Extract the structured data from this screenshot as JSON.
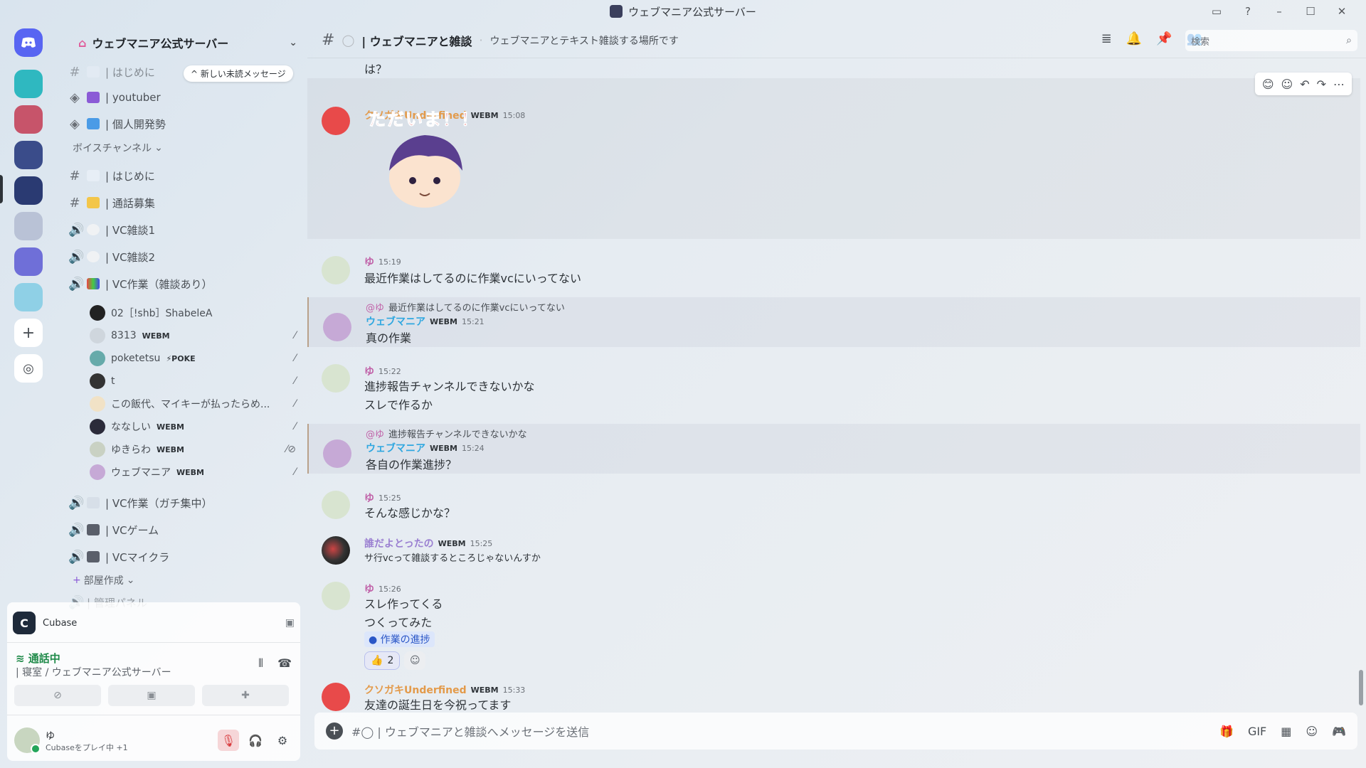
{
  "window": {
    "title": "ウェブマニア公式サーバー",
    "controls": [
      "inbox-icon",
      "help-icon",
      "minimize",
      "maximize",
      "close"
    ],
    "control_glyphs": [
      "▭",
      "?",
      "–",
      "☐",
      "✕"
    ]
  },
  "server_rail": {
    "servers": [
      "discord-home",
      "server-1",
      "server-2",
      "server-3",
      "server-4",
      "server-5",
      "server-6",
      "server-7",
      "add-server",
      "discover"
    ]
  },
  "sidebar": {
    "server_name": "ウェブマニア公式サーバー",
    "unread_pill": "^ 新しい未読メッセージ",
    "top_channels": [
      {
        "label": "| はじめに",
        "emoji": "📖"
      },
      {
        "label": "| youtuber",
        "emoji": "🎬"
      },
      {
        "label": "| 個人開発勢",
        "emoji": "💻"
      }
    ],
    "voice_category": "ボイスチャンネル",
    "voice_channels": [
      {
        "label": "| はじめに",
        "kind": "text"
      },
      {
        "label": "| 通話募集",
        "kind": "text"
      },
      {
        "label": "| VC雑談1",
        "kind": "voice"
      },
      {
        "label": "| VC雑談2",
        "kind": "voice"
      },
      {
        "label": "| VC作業（雑談あり）",
        "kind": "voice"
      }
    ],
    "vc_users": [
      {
        "name": "02［!shb］ShabeleA",
        "tag": ""
      },
      {
        "name": "8313",
        "tag": "WEBM"
      },
      {
        "name": "poketetsu",
        "tag": "⚡POKE"
      },
      {
        "name": "t",
        "tag": ""
      },
      {
        "name": "この飯代、マイキーが払ったらめ...",
        "tag": ""
      },
      {
        "name": "ななしい",
        "tag": "WEBM"
      },
      {
        "name": "ゆきらわ",
        "tag": "WEBM"
      },
      {
        "name": "ウェブマニア",
        "tag": "WEBM"
      }
    ],
    "more_channels": [
      {
        "label": "| VC作業（ガチ集中）"
      },
      {
        "label": "| VCゲーム"
      },
      {
        "label": "| VCマイクラ"
      }
    ],
    "room_category": "部屋作成",
    "partial_channel": "| 管理パネル"
  },
  "user_panel": {
    "app_name": "Cubase",
    "voice_status": "通話中",
    "voice_location": "| 寝室 / ウェブマニア公式サーバー",
    "username": "ゆ",
    "activity": "Cubaseをプレイ中 +1"
  },
  "channel": {
    "name": "| ウェブマニアと雑談",
    "topic": "ウェブマニアとテキスト雑談する場所です",
    "search_placeholder": "検索",
    "composer_placeholder": "| ウェブマニアと雑談へメッセージを送信"
  },
  "messages": [
    {
      "author": "",
      "text": "は？"
    },
    {
      "author": "クソガキUnderfined",
      "tag": "WEBM",
      "time": "15:08",
      "sticker_text": "ただいま！！"
    },
    {
      "author": "ゆ",
      "time": "15:19",
      "text": "最近作業はしてるのに作業vcにいってない"
    },
    {
      "reply_to": "@ゆ",
      "reply_text": "最近作業はしてるのに作業vcにいってない",
      "author": "ウェブマニア",
      "tag": "WEBM",
      "time": "15:21",
      "text": "真の作業"
    },
    {
      "author": "ゆ",
      "time": "15:22",
      "text": "進捗報告チャンネルできないかな",
      "text2": "スレで作るか"
    },
    {
      "reply_to": "@ゆ",
      "reply_text": "進捗報告チャンネルできないかな",
      "author": "ウェブマニア",
      "tag": "WEBM",
      "time": "15:24",
      "text": "各自の作業進捗？"
    },
    {
      "author": "ゆ",
      "time": "15:25",
      "text": "そんな感じかな？"
    },
    {
      "author": "誰だよとったの",
      "tag": "WEBM",
      "time": "15:25",
      "text": "サ行vcって雑談するところじゃないんすか"
    },
    {
      "author": "ゆ",
      "time": "15:26",
      "text": "スレ作ってくる",
      "text2": "つくってみた",
      "thread": "作業の進捗",
      "reaction_count": "2"
    },
    {
      "author": "クソガキUnderfined",
      "tag": "WEBM",
      "time": "15:33",
      "text": "友達の誕生日を今祝ってます"
    }
  ],
  "colors": {
    "accent_pink": "#c061a8",
    "name_blue": "#2fa7e0",
    "name_orange": "#e39a4a",
    "name_purple": "#9a7fd1",
    "online": "#23a55a"
  }
}
